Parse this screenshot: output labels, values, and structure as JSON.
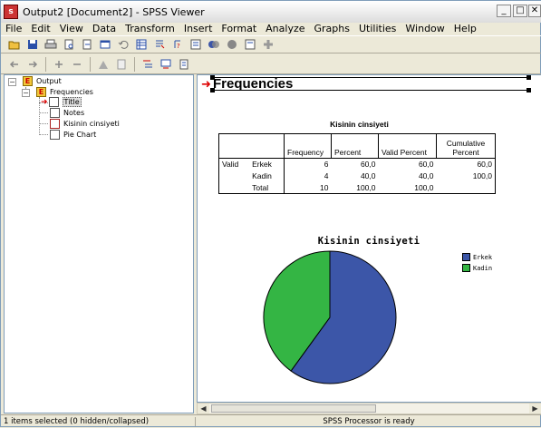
{
  "window": {
    "title": "Output2 [Document2] - SPSS Viewer",
    "app_icon": "spss-icon"
  },
  "controls": {
    "minimize": "_",
    "maximize": "□",
    "close": "✕"
  },
  "menu": [
    "File",
    "Edit",
    "View",
    "Data",
    "Transform",
    "Insert",
    "Format",
    "Analyze",
    "Graphs",
    "Utilities",
    "Window",
    "Help"
  ],
  "tree": {
    "root": "Output",
    "group": "Frequencies",
    "items": [
      "Title",
      "Notes",
      "Kisinin cinsiyeti",
      "Pie Chart"
    ]
  },
  "viewer": {
    "heading": "Frequencies",
    "table": {
      "title": "Kisinin cinsiyeti",
      "columns": [
        "Frequency",
        "Percent",
        "Valid Percent",
        "Cumulative Percent"
      ],
      "group_label": "Valid",
      "rows": [
        {
          "label": "Erkek",
          "frequency": "6",
          "percent": "60,0",
          "valid_percent": "60,0",
          "cumulative": "60,0"
        },
        {
          "label": "Kadin",
          "frequency": "4",
          "percent": "40,0",
          "valid_percent": "40,0",
          "cumulative": "100,0"
        },
        {
          "label": "Total",
          "frequency": "10",
          "percent": "100,0",
          "valid_percent": "100,0",
          "cumulative": ""
        }
      ]
    }
  },
  "chart_data": {
    "type": "pie",
    "title": "Kisinin cinsiyeti",
    "categories": [
      "Erkek",
      "Kadin"
    ],
    "values": [
      6,
      4
    ],
    "colors": [
      "#3c56a8",
      "#34b544"
    ],
    "legend_position": "top-right"
  },
  "status": {
    "left": "1 items selected (0 hidden/collapsed)",
    "center": "SPSS Processor is ready"
  }
}
